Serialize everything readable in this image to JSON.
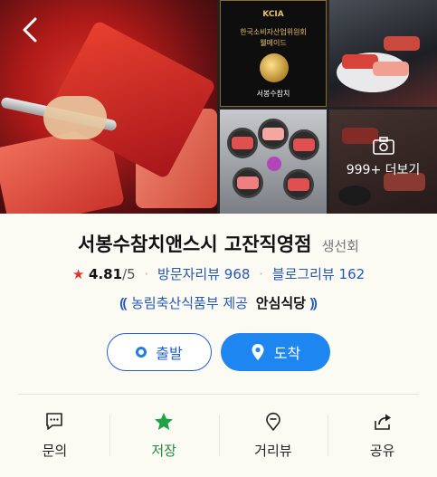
{
  "photos": {
    "more_label": "999+ 더보기",
    "award": {
      "line1": "KCIA",
      "line2": "한국소비자산업위원회",
      "line3": "웰메이드",
      "line4": "서봉수참치"
    }
  },
  "place": {
    "name": "서봉수참치앤스시 고잔직영점",
    "category": "생선회",
    "rating_star": "★",
    "rating": "4.81",
    "rating_max": "/5",
    "visitor_reviews_label": "방문자리뷰 968",
    "blog_reviews_label": "블로그리뷰 162",
    "cert_prefix": "농림축산식품부 제공",
    "cert_name": "안심식당"
  },
  "buttons": {
    "depart": "출발",
    "arrive": "도착"
  },
  "actions": [
    {
      "label": "문의",
      "icon": "chat-icon"
    },
    {
      "label": "저장",
      "icon": "star-icon"
    },
    {
      "label": "거리뷰",
      "icon": "street-view-icon"
    },
    {
      "label": "공유",
      "icon": "share-icon"
    }
  ],
  "colors": {
    "accent_blue": "#1e86f0",
    "link_blue": "#2457b5",
    "star_red": "#e2322b",
    "save_green": "#1f8a3e",
    "background": "#fbfaf3"
  }
}
